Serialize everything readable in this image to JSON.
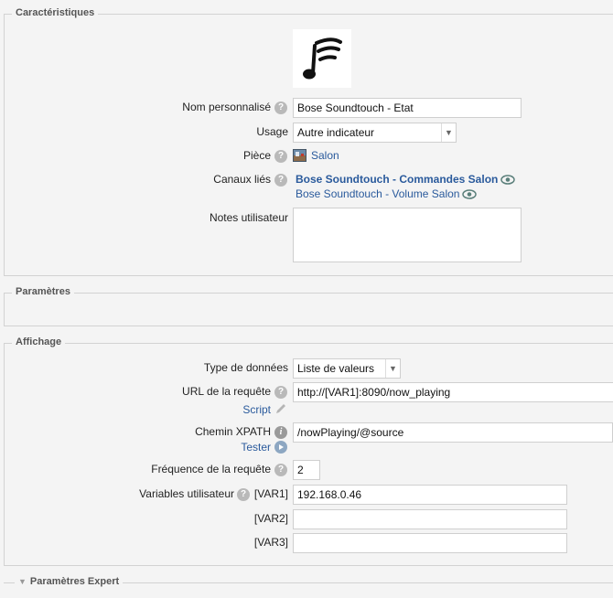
{
  "sections": {
    "characteristics": "Caractéristiques",
    "parameters": "Paramètres",
    "display": "Affichage",
    "expert": "Paramètres Expert"
  },
  "characteristics": {
    "icon": "music-note-signal-icon",
    "name_label": "Nom personnalisé",
    "name_value": "Bose Soundtouch - Etat",
    "usage_label": "Usage",
    "usage_value": "Autre indicateur",
    "room_label": "Pièce",
    "room_value": "Salon",
    "linked_label": "Canaux liés",
    "linked_channels": [
      "Bose Soundtouch - Commandes Salon",
      "Bose Soundtouch - Volume Salon"
    ],
    "notes_label": "Notes utilisateur",
    "notes_value": ""
  },
  "display": {
    "data_type_label": "Type de données",
    "data_type_value": "Liste de valeurs",
    "url_label": "URL de la requête",
    "url_value": "http://[VAR1]:8090/now_playing",
    "script_link": "Script",
    "xpath_label": "Chemin XPATH",
    "xpath_value": "/nowPlaying/@source",
    "test_link": "Tester",
    "frequency_label": "Fréquence de la requête",
    "frequency_value": "2",
    "vars_label": "Variables utilisateur",
    "var1_label": "[VAR1]",
    "var1_value": "192.168.0.46",
    "var2_label": "[VAR2]",
    "var2_value": "",
    "var3_label": "[VAR3]",
    "var3_value": ""
  },
  "icons": {
    "help": "?",
    "info": "i"
  },
  "colors": {
    "link": "#2a5a9c",
    "help": "#b9b9b9",
    "border": "#d2d2d2",
    "background": "#f4f4f4"
  }
}
